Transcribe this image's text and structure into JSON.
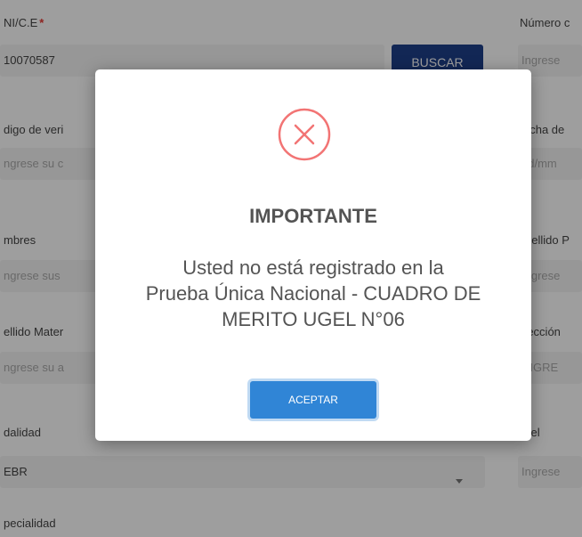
{
  "form": {
    "dni": {
      "label": "NI/C.E",
      "required_mark": "*",
      "value": "10070587"
    },
    "search_button": "BUSCAR",
    "numero": {
      "label": "Número c",
      "placeholder": "Ingrese"
    },
    "codigo": {
      "label": "digo de veri",
      "placeholder": "ngrese su c"
    },
    "fecha": {
      "label": "echa de",
      "placeholder": "dd/mm"
    },
    "nombres": {
      "label": "mbres",
      "placeholder": "ngrese sus"
    },
    "apellido_paterno": {
      "label": "pellido P",
      "placeholder": "Ingrese"
    },
    "apellido_materno": {
      "label": "ellido Mater",
      "placeholder": "ngrese su a"
    },
    "direccion": {
      "label": "rección",
      "placeholder": "INGRE"
    },
    "modalidad": {
      "label": "dalidad",
      "value": "EBR"
    },
    "nivel": {
      "label": "vel",
      "placeholder": "Ingrese"
    },
    "especialidad": {
      "label": "pecialidad"
    }
  },
  "modal": {
    "icon": "error-x-circle-icon",
    "icon_color": "#f27474",
    "title": "IMPORTANTE",
    "message_line1": "Usted no está registrado en la",
    "message_line2": "Prueba Única Nacional - CUADRO DE",
    "message_line3": "MERITO UGEL N°06",
    "button": "ACEPTAR",
    "button_color": "#3085d6"
  }
}
